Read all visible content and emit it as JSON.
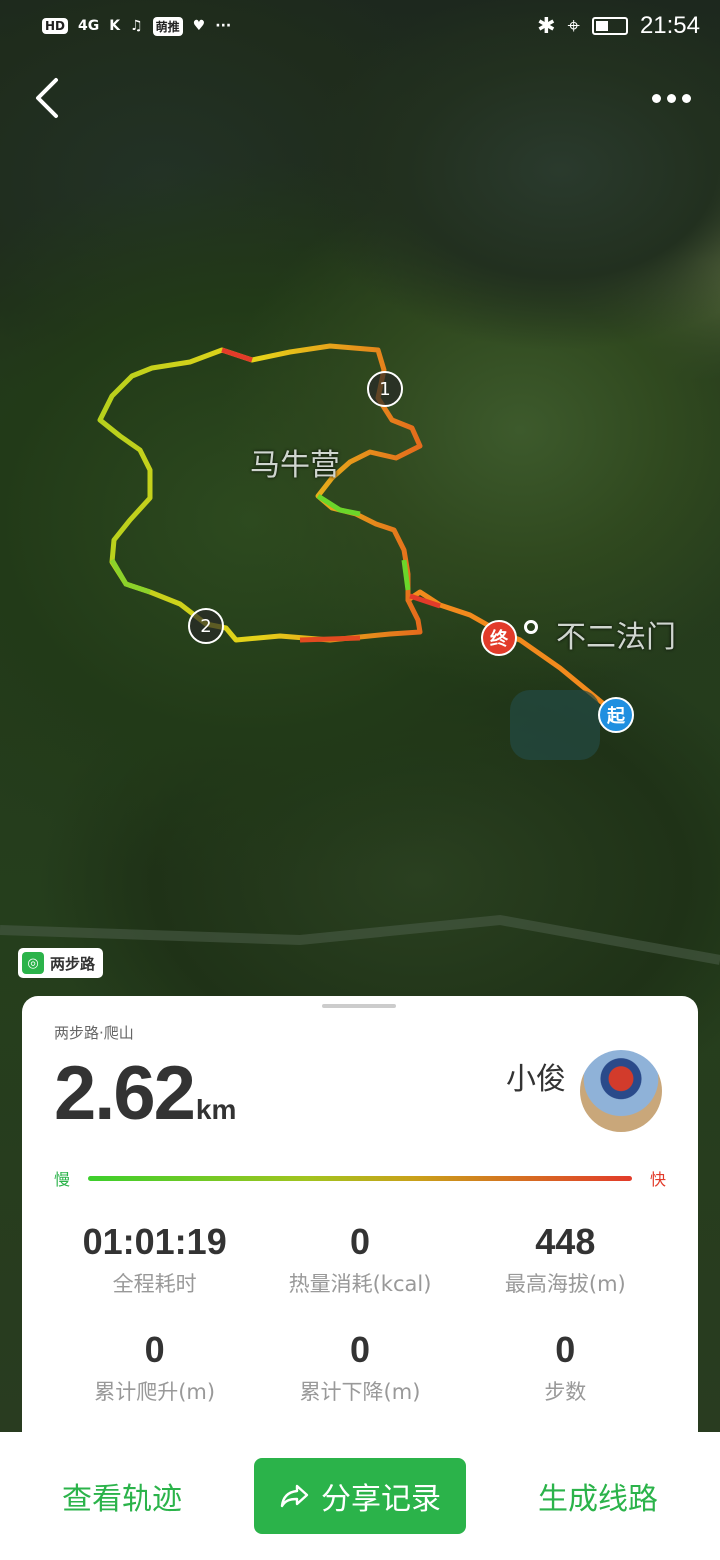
{
  "status_bar": {
    "left_chips": [
      "HD",
      "4G",
      "K",
      "♫",
      "萌推"
    ],
    "time": "21:54"
  },
  "header": {
    "back_icon": "chevron-left-icon",
    "more_icon": "more-dots-icon"
  },
  "map": {
    "labels": [
      "马牛营",
      "不二法门"
    ],
    "start_marker": "起",
    "end_marker": "终",
    "waypoints": [
      "1",
      "2"
    ],
    "brand_tag": "两步路",
    "colors": {
      "track_slow": "#3ccf2c",
      "track_mid": "#e6d21a",
      "track_fast": "#e23b2a",
      "start_color": "#1f8fe0",
      "end_color": "#e23b2a"
    }
  },
  "card": {
    "subtitle": "两步路·爬山",
    "distance_value": "2.62",
    "distance_unit": "km",
    "username": "小俊",
    "speed_slow": "慢",
    "speed_fast": "快",
    "stats": [
      {
        "value": "01:01:19",
        "label": "全程耗时"
      },
      {
        "value": "0",
        "label": "热量消耗(kcal)"
      },
      {
        "value": "448",
        "label": "最高海拔(m)"
      },
      {
        "value": "0",
        "label": "累计爬升(m)"
      },
      {
        "value": "0",
        "label": "累计下降(m)"
      },
      {
        "value": "0",
        "label": "步数"
      }
    ]
  },
  "bottom_bar": {
    "view_track": "查看轨迹",
    "share_record": "分享记录",
    "generate_route": "生成线路",
    "accent": "#2bb34a"
  }
}
